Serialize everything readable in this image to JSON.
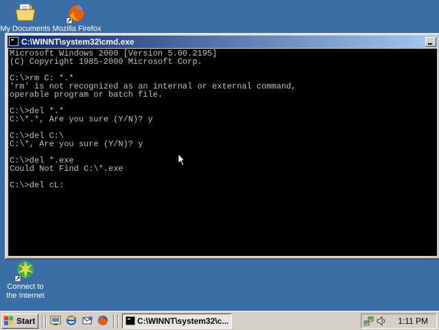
{
  "desktop": {
    "icons": [
      {
        "label": "My Documents"
      },
      {
        "label": "Mozilla Firefox"
      },
      {
        "label_line1": "Connect to",
        "label_line2": "the Internet"
      }
    ]
  },
  "window": {
    "title": "C:\\WINNT\\system32\\cmd.exe",
    "console_lines": [
      "Microsoft Windows 2000 [Version 5.00.2195]",
      "(C) Copyright 1985-2000 Microsoft Corp.",
      "",
      "C:\\>rm C: *.*",
      "'rm' is not recognized as an internal or external command,",
      "operable program or batch file.",
      "",
      "C:\\>del *.*",
      "C:\\*.*, Are you sure (Y/N)? y",
      "",
      "C:\\>del C:\\",
      "C:\\*, Are you sure (Y/N)? y",
      "",
      "C:\\>del *.exe",
      "Could Not Find C:\\*.exe",
      "",
      "C:\\>del cL:"
    ]
  },
  "taskbar": {
    "start_label": "Start",
    "task_label": "C:\\WINNT\\system32\\c...",
    "clock": "1:11 PM"
  },
  "colors": {
    "desktop": "#3a6ea5",
    "titlebar_start": "#0a246a",
    "titlebar_end": "#a6caf0",
    "console_bg": "#000000",
    "console_text": "#c0c0c0",
    "chrome": "#d4d0c8"
  },
  "icons": {
    "desktop": [
      "folder-documents-icon",
      "firefox-icon",
      "connect-internet-icon"
    ],
    "quick_launch": [
      "show-desktop-icon",
      "internet-explorer-icon",
      "outlook-express-icon",
      "firefox-icon"
    ],
    "tray": [
      "network-icon",
      "volume-icon"
    ]
  }
}
